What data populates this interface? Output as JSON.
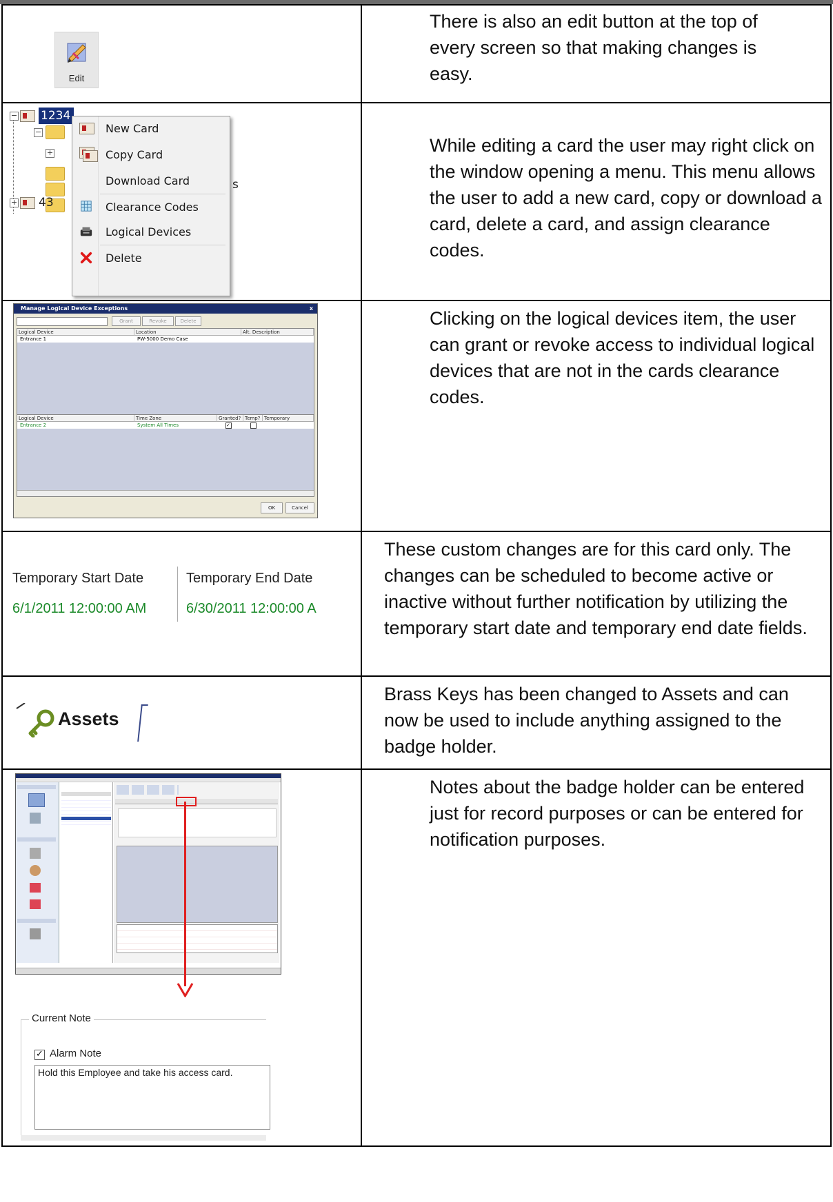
{
  "rows": [
    {
      "edit_label": "Edit",
      "text": "There is also an edit button at the top of every screen so that making changes is easy."
    },
    {
      "tree_root_label": "1234",
      "tree_sibling_label": "43",
      "partial_label": "s",
      "menu_items": [
        "New Card",
        "Copy Card",
        "Download Card",
        "Clearance Codes",
        "Logical Devices",
        "Delete"
      ],
      "text": "While editing a card the user may right click on the window opening a menu. This menu allows the user to add a new card, copy or download a card, delete a card, and assign clearance codes."
    },
    {
      "dialog_title": "Manage Logical Device Exceptions",
      "dialog_close": "x",
      "buttons": [
        "Grant",
        "Revoke",
        "Delete"
      ],
      "upper_headers": [
        "Logical Device",
        "Location",
        "Alt. Description"
      ],
      "upper_row": [
        "Entrance 1",
        "PW-5000 Demo Case"
      ],
      "lower_headers": [
        "Logical Device",
        "Time Zone",
        "Granted?",
        "Temp?",
        "Temporary"
      ],
      "lower_row": [
        "Entrance 2",
        "System All Times"
      ],
      "ok": "OK",
      "cancel": "Cancel",
      "text": "Clicking on the logical devices item, the user can grant or revoke access to individual logical devices that are not in the cards clearance codes."
    },
    {
      "headers": [
        "Temporary Start Date",
        "Temporary End Date"
      ],
      "values": [
        "6/1/2011 12:00:00 AM",
        "6/30/2011 12:00:00 A"
      ],
      "text": "These custom changes are for this card only. The changes can be scheduled to become active or inactive without further notification by utilizing the temporary start date and temporary end date fields."
    },
    {
      "assets_label": "Assets",
      "text": "Brass Keys has been changed to Assets and can now be used to include anything assigned to the badge holder."
    },
    {
      "current_note_title": "Current Note",
      "alarm_note_label": "Alarm Note",
      "note_text": "Hold this Employee and take his access card.",
      "text": "Notes about the badge holder can be entered just for record purposes or can be entered for notification purposes."
    }
  ],
  "colors": {
    "accent_red": "#e02020",
    "date_green": "#1c8a2a",
    "title_blue": "#1b2e6b"
  }
}
